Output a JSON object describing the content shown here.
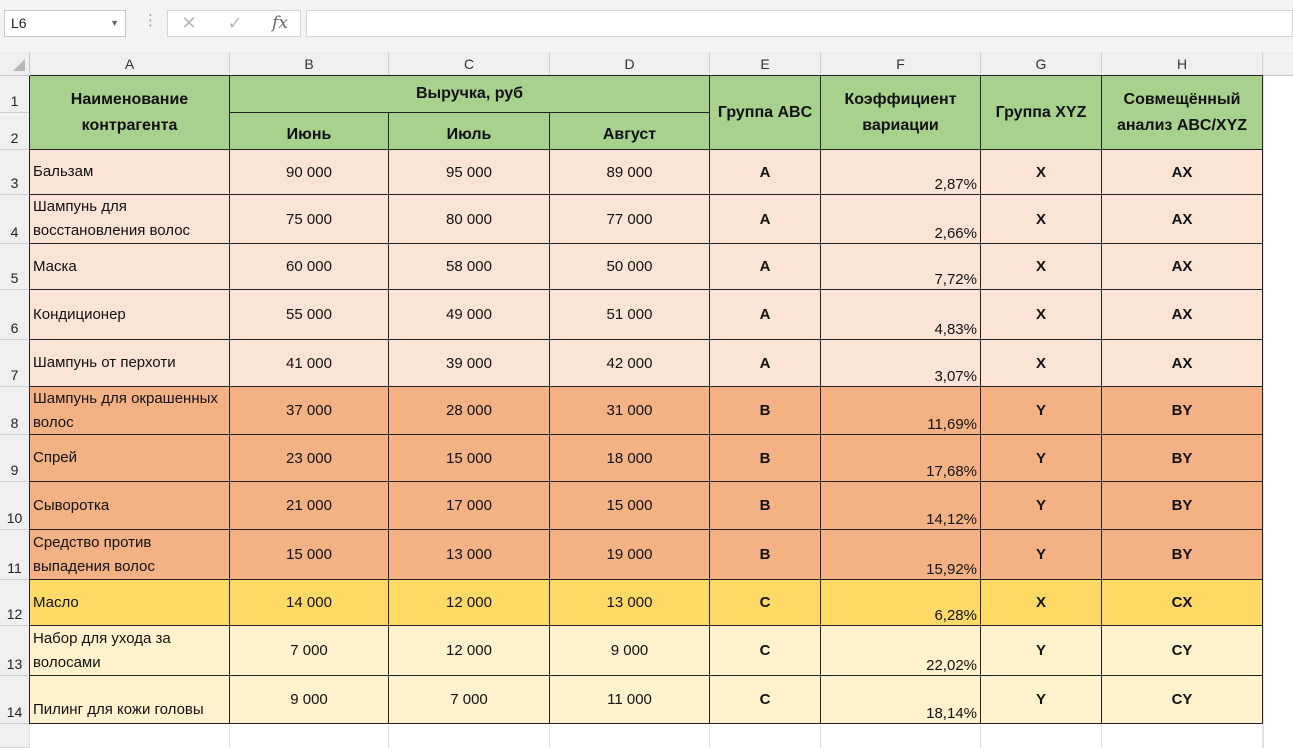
{
  "formula_bar": {
    "name_box": "L6",
    "cancel_icon": "✕",
    "enter_icon": "✓",
    "fx_icon": "fx",
    "formula": ""
  },
  "columns": [
    "A",
    "B",
    "C",
    "D",
    "E",
    "F",
    "G",
    "H"
  ],
  "header": {
    "name": "Наименование контрагента",
    "revenue": "Выручка, руб",
    "months": [
      "Июнь",
      "Июль",
      "Август"
    ],
    "abc": "Группа ABC",
    "coef": "Коэффициент вариации",
    "xyz": "Группа XYZ",
    "combined": "Совмещённый анализ ABC/XYZ"
  },
  "row_numbers": [
    "1",
    "2",
    "3",
    "4",
    "5",
    "6",
    "7",
    "8",
    "9",
    "10",
    "11",
    "12",
    "13",
    "14"
  ],
  "colors": {
    "header": "#a9d18e",
    "group_ax": "#fbe4d5",
    "group_by": "#f4b183",
    "group_cx": "#ffd966",
    "group_cy": "#fff2cc"
  },
  "rows": [
    {
      "name": "Бальзам",
      "jun": "90 000",
      "jul": "95 000",
      "aug": "89 000",
      "abc": "A",
      "coef": "2,87%",
      "xyz": "X",
      "combined": "AX"
    },
    {
      "name": "Шампунь для восстановления волос",
      "jun": "75 000",
      "jul": "80 000",
      "aug": "77 000",
      "abc": "A",
      "coef": "2,66%",
      "xyz": "X",
      "combined": "AX"
    },
    {
      "name": "Маска",
      "jun": "60 000",
      "jul": "58 000",
      "aug": "50 000",
      "abc": "A",
      "coef": "7,72%",
      "xyz": "X",
      "combined": "AX"
    },
    {
      "name": "Кондиционер",
      "jun": "55 000",
      "jul": "49 000",
      "aug": "51 000",
      "abc": "A",
      "coef": "4,83%",
      "xyz": "X",
      "combined": "AX"
    },
    {
      "name": "Шампунь от перхоти",
      "jun": "41 000",
      "jul": "39 000",
      "aug": "42 000",
      "abc": "A",
      "coef": "3,07%",
      "xyz": "X",
      "combined": "AX"
    },
    {
      "name": "Шампунь для окрашенных волос",
      "jun": "37 000",
      "jul": "28 000",
      "aug": "31 000",
      "abc": "B",
      "coef": "11,69%",
      "xyz": "Y",
      "combined": "BY"
    },
    {
      "name": "Спрей",
      "jun": "23 000",
      "jul": "15 000",
      "aug": "18 000",
      "abc": "B",
      "coef": "17,68%",
      "xyz": "Y",
      "combined": "BY"
    },
    {
      "name": "Сыворотка",
      "jun": "21 000",
      "jul": "17 000",
      "aug": "15 000",
      "abc": "B",
      "coef": "14,12%",
      "xyz": "Y",
      "combined": "BY"
    },
    {
      "name": "Средство против выпадения волос",
      "jun": "15 000",
      "jul": "13 000",
      "aug": "19 000",
      "abc": "B",
      "coef": "15,92%",
      "xyz": "Y",
      "combined": "BY"
    },
    {
      "name": "Масло",
      "jun": "14 000",
      "jul": "12 000",
      "aug": "13 000",
      "abc": "C",
      "coef": "6,28%",
      "xyz": "X",
      "combined": "CX"
    },
    {
      "name": "Набор для ухода за волосами",
      "jun": "7 000",
      "jul": "12 000",
      "aug": "9 000",
      "abc": "C",
      "coef": "22,02%",
      "xyz": "Y",
      "combined": "CY"
    },
    {
      "name": "Пилинг для кожи головы",
      "jun": "9 000",
      "jul": "7 000",
      "aug": "11 000",
      "abc": "C",
      "coef": "18,14%",
      "xyz": "Y",
      "combined": "CY"
    }
  ]
}
